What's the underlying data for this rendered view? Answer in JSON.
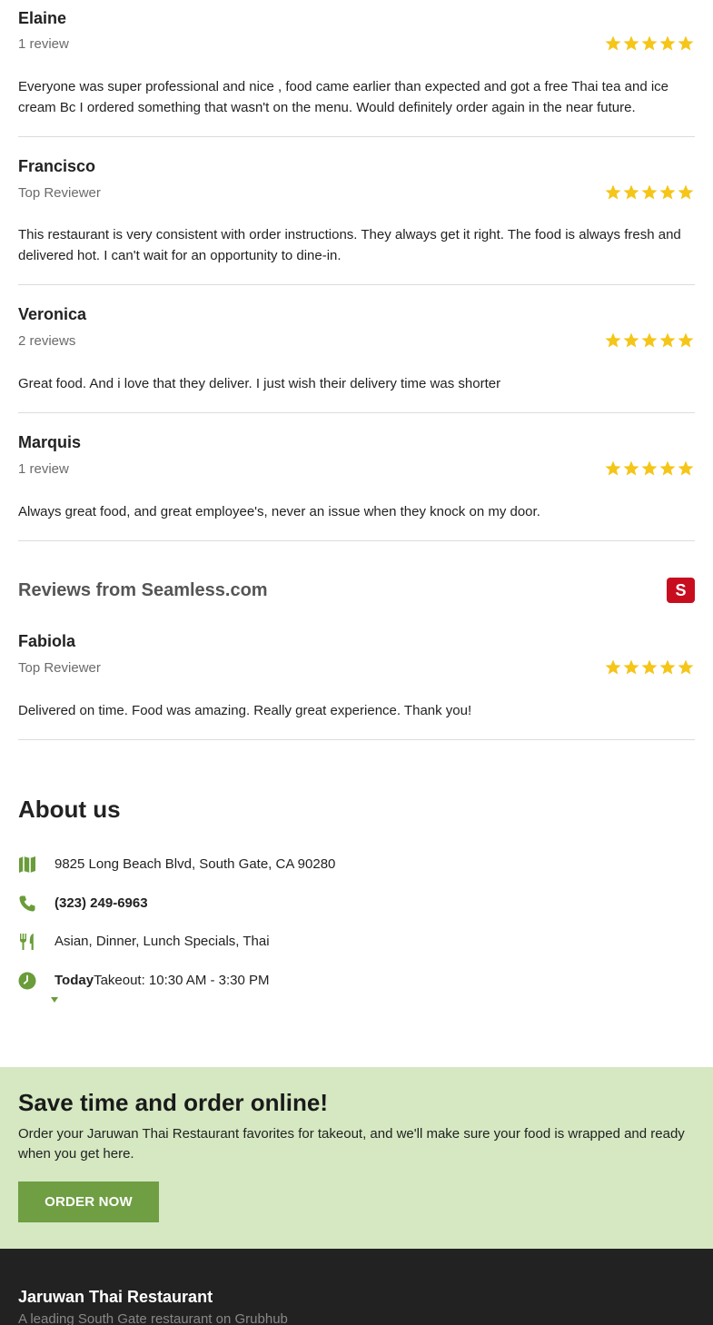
{
  "reviews": [
    {
      "name": "Elaine",
      "meta": "1 review",
      "rating": 5,
      "text": "Everyone was super professional and nice , food came earlier than expected and got a free Thai tea and ice cream Bc I ordered something that wasn't on the menu. Would definitely order again in the near future."
    },
    {
      "name": "Francisco",
      "meta": "Top Reviewer",
      "rating": 5,
      "text": "This restaurant is very consistent with order instructions. They always get it right. The food is always fresh and delivered hot. I can't wait for an opportunity to dine-in."
    },
    {
      "name": "Veronica",
      "meta": "2 reviews",
      "rating": 5,
      "text": "Great food. And i love that they deliver. I just wish their delivery time was shorter"
    },
    {
      "name": "Marquis",
      "meta": "1 review",
      "rating": 5,
      "text": "Always great food, and great employee's, never an issue when they knock on my door."
    }
  ],
  "seamless": {
    "title": "Reviews from Seamless.com",
    "logo_letter": "S",
    "review": {
      "name": "Fabiola",
      "meta": "Top Reviewer",
      "rating": 5,
      "text": "Delivered on time. Food was amazing. Really great experience. Thank you!"
    }
  },
  "about": {
    "heading": "About us",
    "address": "9825 Long Beach Blvd, South Gate, CA 90280",
    "phone": "(323) 249-6963",
    "cuisines": "Asian, Dinner, Lunch Specials, Thai",
    "hours_day": "Today",
    "hours_text": "Takeout: 10:30 AM - 3:30 PM"
  },
  "cta": {
    "heading": "Save time and order online!",
    "text": "Order your Jaruwan Thai Restaurant favorites for takeout, and we'll make sure your food is wrapped and ready when you get here.",
    "button": "ORDER NOW"
  },
  "footer": {
    "name": "Jaruwan Thai Restaurant",
    "tagline": "A leading South Gate restaurant on Grubhub"
  },
  "colors": {
    "star": "#f5c518",
    "accent_green": "#6f9e43",
    "icon_green": "#6a9c3a",
    "cta_bg": "#d5e8c1",
    "seamless_red": "#c80d1f",
    "footer_bg": "#222222"
  },
  "icons": {
    "address": "map-icon",
    "phone": "phone-icon",
    "cuisine": "fork-knife-icon",
    "hours": "clock-icon",
    "star": "star-icon"
  }
}
